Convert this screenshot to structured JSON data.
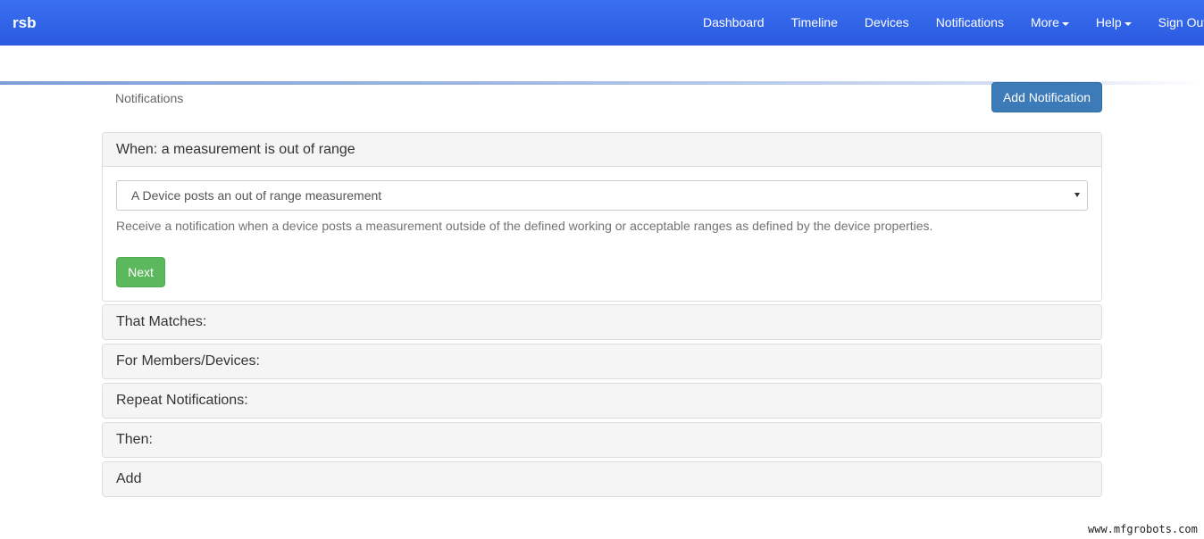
{
  "navbar": {
    "brand": "rsb",
    "items": [
      {
        "label": "Dashboard",
        "dropdown": false
      },
      {
        "label": "Timeline",
        "dropdown": false
      },
      {
        "label": "Devices",
        "dropdown": false
      },
      {
        "label": "Notifications",
        "dropdown": false
      },
      {
        "label": "More",
        "dropdown": true
      },
      {
        "label": "Help",
        "dropdown": true
      },
      {
        "label": "Sign Out",
        "dropdown": false
      }
    ],
    "color": "#2f62e8"
  },
  "page": {
    "breadcrumb": "Notifications",
    "add_button": "Add Notification"
  },
  "steps": {
    "when": {
      "title": "When: a measurement is out of range",
      "select_value": "A Device posts an out of range measurement",
      "help": "Receive a notification when a device posts a measurement outside of the defined working or acceptable ranges as defined by the device properties.",
      "next_label": "Next"
    },
    "matches": "That Matches:",
    "members": "For Members/Devices:",
    "repeat": "Repeat Notifications:",
    "then": "Then:",
    "add": "Add"
  },
  "watermark": "www.mfgrobots.com"
}
